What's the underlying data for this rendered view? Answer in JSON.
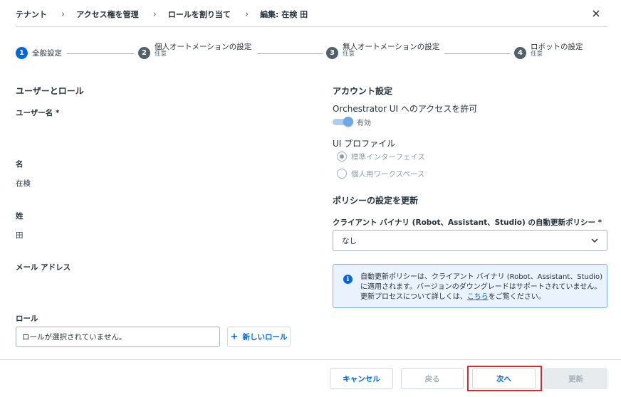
{
  "breadcrumb": [
    "テナント",
    "アクセス権を管理",
    "ロールを割り当て",
    "編集: 在検 田"
  ],
  "stepper": {
    "steps": [
      {
        "number": "1",
        "label": "全般設定",
        "sub": ""
      },
      {
        "number": "2",
        "label": "個人オートメーションの設定",
        "sub": "任意"
      },
      {
        "number": "3",
        "label": "無人オートメーションの設定",
        "sub": "任意"
      },
      {
        "number": "4",
        "label": "ロボットの設定",
        "sub": "任意"
      }
    ]
  },
  "left": {
    "section_title": "ユーザーとロール",
    "username_label": "ユーザー名 *",
    "first_name_label": "名",
    "first_name_value": "在検",
    "last_name_label": "姓",
    "last_name_value": "田",
    "email_label": "メール アドレス",
    "role_label": "ロール",
    "role_placeholder": "ロールが選択されていません。",
    "new_role_label": "新しいロール"
  },
  "right": {
    "account_title": "アカウント設定",
    "orchestrator_access_label": "Orchestrator UI へのアクセスを許可",
    "toggle_text": "有効",
    "ui_profile_label": "UI プロファイル",
    "profile_options": [
      "標準インターフェイス",
      "個人用ワークスペース"
    ],
    "profile_selected": "標準インターフェイス",
    "policy_title": "ポリシーの設定を更新",
    "policy_field_label": "クライアント バイナリ (Robot、Assistant、Studio) の自動更新ポリシー *",
    "policy_value": "なし",
    "info_text_1": "自動更新ポリシーは、クライアント バイナリ (Robot、Assistant、Studio) に適用されます。バージョンのダウングレードはサポートされていません。更新プロセスについて詳しくは、",
    "info_link": "こちら",
    "info_text_2": "をご覧ください。"
  },
  "footer": {
    "cancel": "キャンセル",
    "back": "戻る",
    "next": "次へ",
    "update": "更新"
  },
  "colors": {
    "accent": "#0067df",
    "highlight": "#e8232a"
  }
}
